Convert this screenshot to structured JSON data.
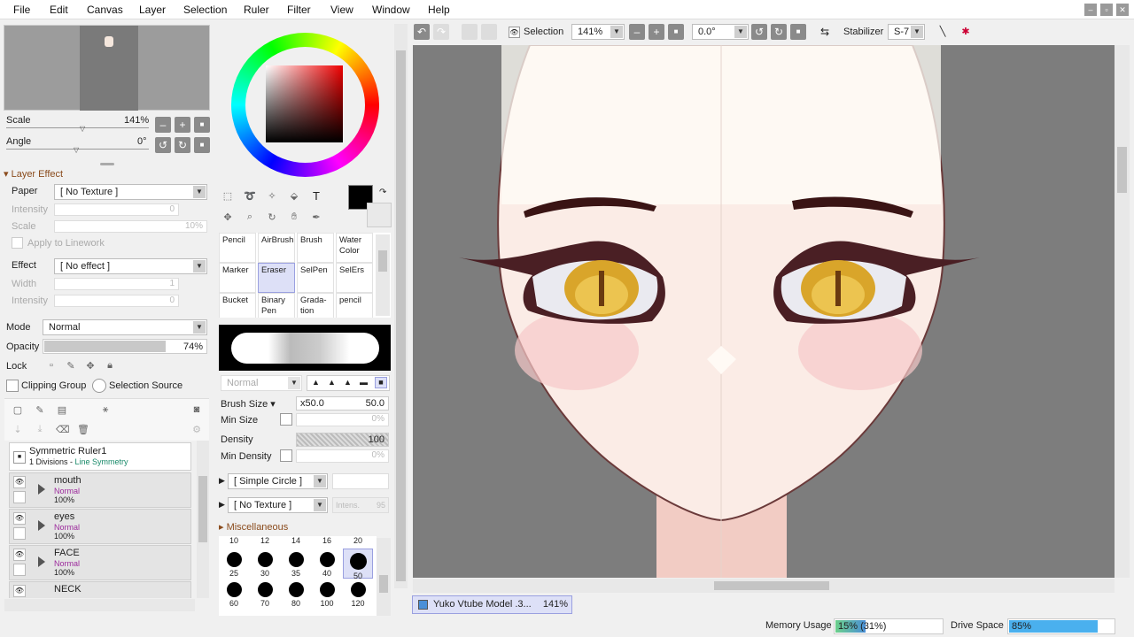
{
  "menu": [
    "File",
    "Edit",
    "Canvas",
    "Layer",
    "Selection",
    "Ruler",
    "Filter",
    "View",
    "Window",
    "Help"
  ],
  "navigator": {
    "scale_label": "Scale",
    "scale_value": "141%",
    "angle_label": "Angle",
    "angle_value": "0°"
  },
  "layer_effect": {
    "header": "Layer Effect",
    "paper_label": "Paper",
    "paper_value": "[ No Texture ]",
    "intensity_label": "Intensity",
    "intensity_value": "0",
    "scale_label": "Scale",
    "scale_value": "10%",
    "apply_label": "Apply to Linework",
    "effect_label": "Effect",
    "effect_value": "[ No effect ]",
    "width_label": "Width",
    "width_value": "1",
    "intensity2_label": "Intensity",
    "intensity2_value": "0"
  },
  "layer_props": {
    "mode_label": "Mode",
    "mode_value": "Normal",
    "opacity_label": "Opacity",
    "opacity_value": "74%",
    "lock_label": "Lock",
    "clipping_label": "Clipping Group",
    "selection_source_label": "Selection Source"
  },
  "ruler": {
    "name": "Symmetric Ruler1",
    "div": "1 Divisions - ",
    "sym": "Line Symmetry"
  },
  "layers": [
    {
      "name": "mouth",
      "mode": "Normal",
      "opacity": "100%"
    },
    {
      "name": "eyes",
      "mode": "Normal",
      "opacity": "100%"
    },
    {
      "name": "FACE",
      "mode": "Normal",
      "opacity": "100%"
    },
    {
      "name": "NECK",
      "mode": "",
      "opacity": ""
    }
  ],
  "tools": [
    {
      "label": "Pencil"
    },
    {
      "label": "AirBrush"
    },
    {
      "label": "Brush"
    },
    {
      "label": "Water Color"
    },
    {
      "label": "Marker"
    },
    {
      "label": "Eraser"
    },
    {
      "label": "SelPen"
    },
    {
      "label": "SelErs"
    },
    {
      "label": "Bucket"
    },
    {
      "label": "Binary Pen"
    },
    {
      "label": "Grada-tion"
    },
    {
      "label": "pencil"
    }
  ],
  "brush": {
    "blend_mode": "Normal",
    "size_label": "Brush Size",
    "size_mult": "x50.0",
    "size_value": "50.0",
    "min_size_label": "Min Size",
    "min_size_value": "0%",
    "density_label": "Density",
    "density_value": "100",
    "min_density_label": "Min Density",
    "min_density_value": "0%",
    "shape_value": "[ Simple Circle ]",
    "texture_value": "[ No Texture ]",
    "intens_label": "Intens.",
    "intens_value": "95",
    "misc_label": "Miscellaneous"
  },
  "brush_sizes_header": [
    "10",
    "12",
    "14",
    "16",
    "20"
  ],
  "brush_sizes_row1": [
    "25",
    "30",
    "35",
    "40",
    "50"
  ],
  "brush_sizes_row2": [
    "60",
    "70",
    "80",
    "100",
    "120"
  ],
  "toolbar": {
    "selection_label": "Selection",
    "zoom_value": "141%",
    "rotation_value": "0.0°",
    "stabilizer_label": "Stabilizer",
    "stabilizer_value": "S-7"
  },
  "document": {
    "name": "Yuko Vtube Model .3...",
    "zoom": "141%"
  },
  "status": {
    "memory_label": "Memory Usage",
    "memory_value": "15% (31%)",
    "memory_fill": 0.15,
    "drive_label": "Drive Space",
    "drive_value": "85%",
    "drive_fill": 0.85
  },
  "colors": {
    "accent": "#4a8fd8",
    "canvas_bg": "#7d7d7d",
    "skin": "#fdf6f0",
    "iris": "#d9a52a"
  }
}
